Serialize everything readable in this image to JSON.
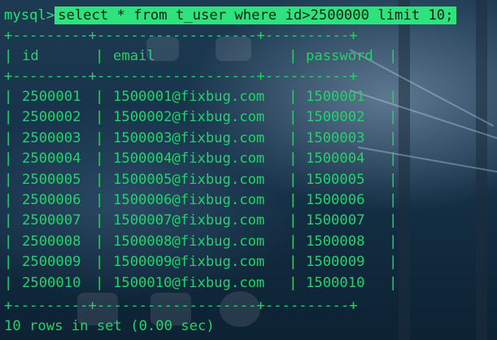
{
  "terminal": {
    "prompt": "mysql>",
    "command": "select * from t_user where id>2500000 limit 10;",
    "separator": "+---------+-------------------+----------+",
    "columns": [
      "id",
      "email",
      "password"
    ],
    "rows": [
      [
        "2500001",
        "1500001@fixbug.com",
        "1500001"
      ],
      [
        "2500002",
        "1500002@fixbug.com",
        "1500002"
      ],
      [
        "2500003",
        "1500003@fixbug.com",
        "1500003"
      ],
      [
        "2500004",
        "1500004@fixbug.com",
        "1500004"
      ],
      [
        "2500005",
        "1500005@fixbug.com",
        "1500005"
      ],
      [
        "2500006",
        "1500006@fixbug.com",
        "1500006"
      ],
      [
        "2500007",
        "1500007@fixbug.com",
        "1500007"
      ],
      [
        "2500008",
        "1500008@fixbug.com",
        "1500008"
      ],
      [
        "2500009",
        "1500009@fixbug.com",
        "1500009"
      ],
      [
        "2500010",
        "1500010@fixbug.com",
        "1500010"
      ]
    ],
    "footer": "10 rows in set (0.00 sec)"
  },
  "colors": {
    "text": "#22d36b",
    "command_highlight": "#2ee37c",
    "background": "#1a3346"
  }
}
